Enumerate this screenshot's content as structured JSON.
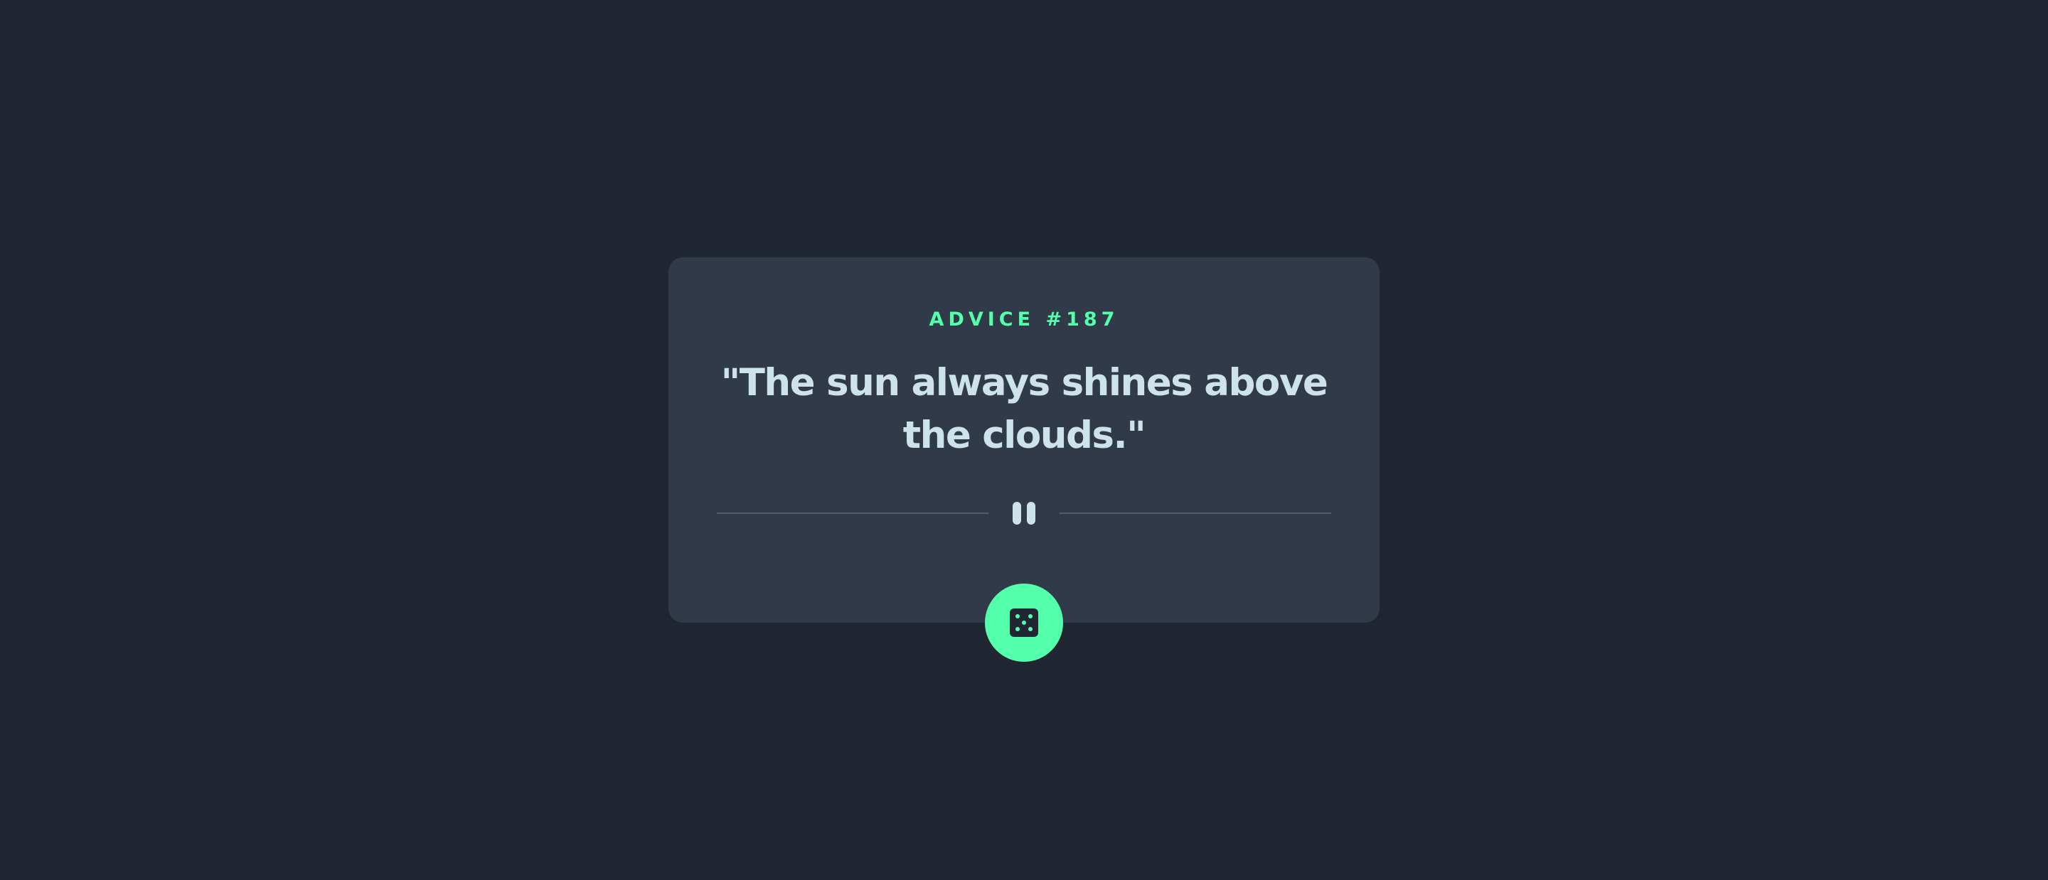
{
  "advice": {
    "id_label": "ADVICE #187",
    "text": "\"The sun always shines above the clouds.\""
  },
  "icons": {
    "divider": "pause-icon",
    "button": "dice-icon"
  },
  "colors": {
    "background": "#202632",
    "card": "#313a49",
    "accent": "#53ffaa",
    "text": "#cee3e9",
    "divider": "#4f5d74"
  }
}
